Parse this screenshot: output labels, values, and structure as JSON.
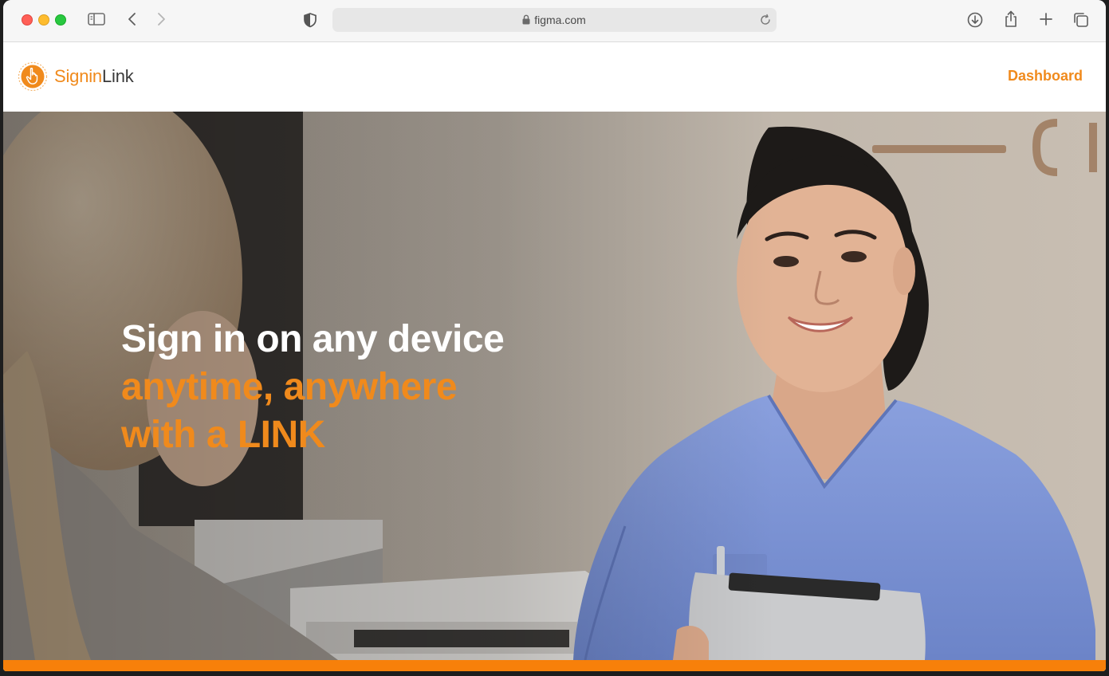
{
  "browser": {
    "url": "figma.com",
    "icons": [
      "sidebar-toggle-icon",
      "back-icon",
      "forward-icon",
      "shield-icon",
      "lock-icon",
      "reload-icon",
      "download-icon",
      "share-icon",
      "new-tab-icon",
      "tabs-overview-icon"
    ]
  },
  "header": {
    "logo_signin": "Signin",
    "logo_link": "Link",
    "nav_dashboard": "Dashboard"
  },
  "hero": {
    "line1": "Sign in on any device",
    "line2": "anytime, anywhere",
    "line3": "with a LINK"
  },
  "colors": {
    "brand_orange": "#f08a1c",
    "accent_bar": "#f7800a",
    "scrubs_blue": "#7b93d6"
  }
}
